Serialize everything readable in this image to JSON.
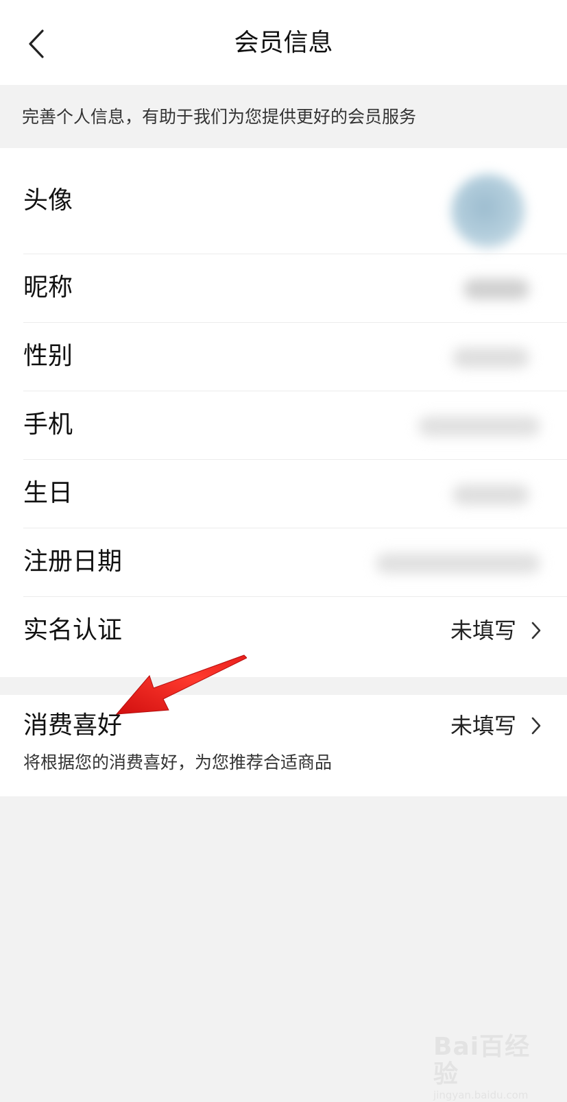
{
  "header": {
    "title": "会员信息",
    "back_icon": "chevron-left-icon"
  },
  "tip": "完善个人信息，有助于我们为您提供更好的会员服务",
  "profile_rows": [
    {
      "label": "头像"
    },
    {
      "label": "昵称"
    },
    {
      "label": "性别"
    },
    {
      "label": "手机"
    },
    {
      "label": "生日"
    },
    {
      "label": "注册日期"
    },
    {
      "label": "实名认证",
      "value": "未填写"
    }
  ],
  "preference": {
    "label": "消费喜好",
    "value": "未填写",
    "description": "将根据您的消费喜好，为您推荐合适商品"
  },
  "annotation": {
    "arrow_color": "#e8201d"
  },
  "watermark": {
    "brand": "Bai百经验",
    "url": "jingyan.baidu.com"
  }
}
